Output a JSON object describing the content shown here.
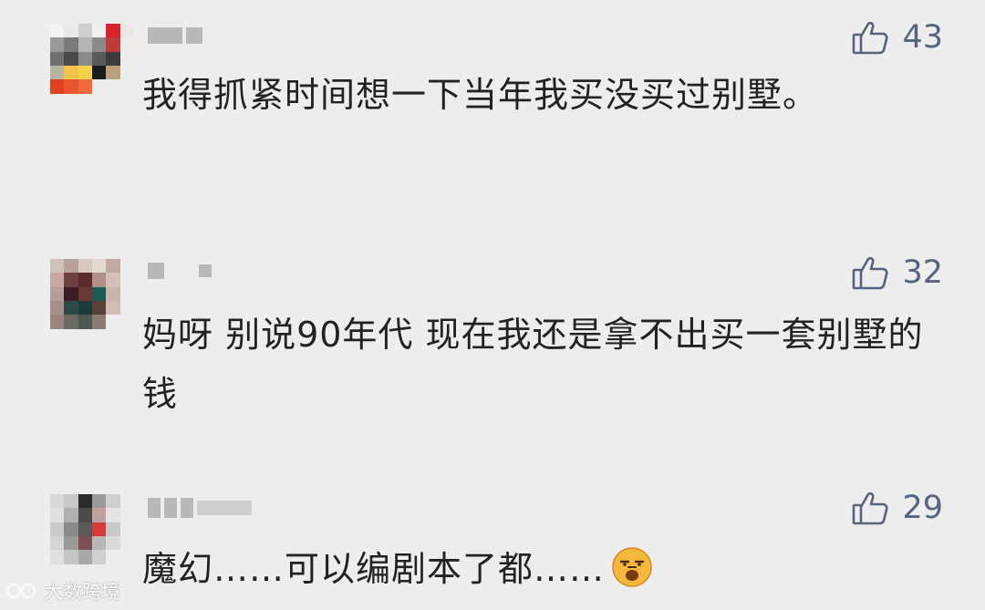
{
  "comments": [
    {
      "likes": "43",
      "text": "我得抓紧时间想一下当年我买没买过别墅。",
      "avatar_colors": [
        "#f2f2f2",
        "#e9e9e9",
        "#cfcfcf",
        "#f0f0f0",
        "#d6222a",
        "#e8e8e8",
        "#9a9a9a",
        "#7a7a7a",
        "#b5b5b5",
        "#8a8a8a",
        "#c23b3b",
        "#ededed",
        "#6f6f6f",
        "#4a4a4a",
        "#8a8a8a",
        "#5a5a5a",
        "#3b3b3b",
        "#ededed",
        "#b7b7a0",
        "#f3c34c",
        "#f5d04a",
        "#1c1c1c",
        "#b8a27c",
        "#ededed",
        "#e0411f",
        "#ea5530",
        "#f06a3a",
        "#ededed",
        "#ededed",
        "#ededed",
        "#ededed",
        "#ededed",
        "#ededed",
        "#ededed",
        "#ededed",
        "#ededed"
      ]
    },
    {
      "likes": "32",
      "text": "妈呀 别说90年代 现在我还是拿不出买一套别墅的钱",
      "avatar_colors": [
        "#cfc0bc",
        "#b8a09c",
        "#d8c8c0",
        "#e4d8d2",
        "#c2aaa2",
        "#ededed",
        "#c8a8a0",
        "#6e4040",
        "#5a2a2c",
        "#b09088",
        "#d4c0b8",
        "#ededed",
        "#b4a09a",
        "#3a1c22",
        "#6a3838",
        "#1e5a54",
        "#c8b4ac",
        "#ededed",
        "#a8908a",
        "#2a4a48",
        "#1a3c3a",
        "#5a4038",
        "#d0bcb4",
        "#ededed",
        "#9c8480",
        "#6a6a60",
        "#4a5a50",
        "#8a7a72",
        "#ededed",
        "#ededed",
        "#ededed",
        "#ededed",
        "#ededed",
        "#ededed",
        "#ededed",
        "#ededed"
      ]
    },
    {
      "likes": "29",
      "text": "魔幻……可以编剧本了都……",
      "avatar_colors": [
        "#d8d8d8",
        "#c8c8c8",
        "#2a2a2a",
        "#9a9a9a",
        "#d0d0d0",
        "#ededed",
        "#e0e0e0",
        "#b0b0b0",
        "#4a4a4a",
        "#c0a0a0",
        "#e4e4e4",
        "#ededed",
        "#cacaca",
        "#8a8a8a",
        "#5a5a5a",
        "#d83a3a",
        "#c8c8c8",
        "#ededed",
        "#d4d4d4",
        "#9a9a9a",
        "#7a5050",
        "#b8b8b8",
        "#dadada",
        "#ededed",
        "#e0e0e0",
        "#c4c4c4",
        "#a8a8a8",
        "#d0d0d0",
        "#ededed",
        "#ededed",
        "#ededed",
        "#ededed",
        "#ededed",
        "#ededed",
        "#ededed",
        "#ededed"
      ]
    }
  ],
  "icons": {
    "like": "thumbs-up-icon",
    "emoji": "unamused-face-emoji"
  },
  "colors": {
    "background": "#ededed",
    "like_count": "#56647e",
    "text": "#222222"
  },
  "watermark": {
    "text": "大数跨境"
  }
}
